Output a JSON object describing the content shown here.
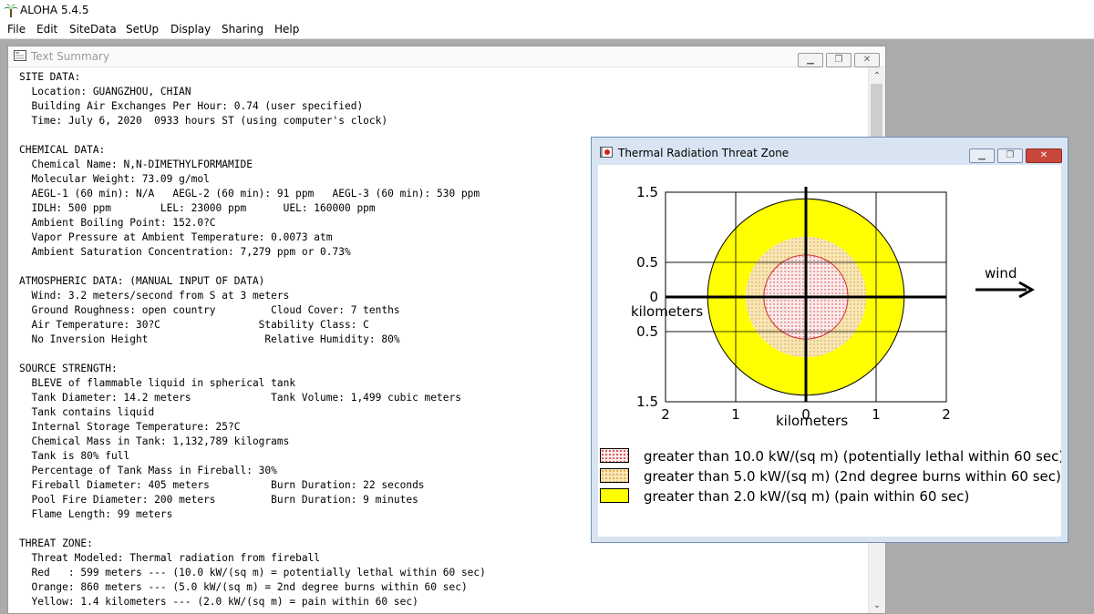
{
  "app": {
    "title": "ALOHA 5.4.5",
    "menu": [
      "File",
      "Edit",
      "SiteData",
      "SetUp",
      "Display",
      "Sharing",
      "Help"
    ]
  },
  "text_summary": {
    "title": "Text Summary",
    "lines": [
      "SITE DATA:",
      "  Location: GUANGZHOU, CHIAN",
      "  Building Air Exchanges Per Hour: 0.74 (user specified)",
      "  Time: July 6, 2020  0933 hours ST (using computer's clock)",
      "",
      "CHEMICAL DATA:",
      "  Chemical Name: N,N-DIMETHYLFORMAMIDE",
      "  Molecular Weight: 73.09 g/mol",
      "  AEGL-1 (60 min): N/A   AEGL-2 (60 min): 91 ppm   AEGL-3 (60 min): 530 ppm",
      "  IDLH: 500 ppm        LEL: 23000 ppm      UEL: 160000 ppm",
      "  Ambient Boiling Point: 152.0?C",
      "  Vapor Pressure at Ambient Temperature: 0.0073 atm",
      "  Ambient Saturation Concentration: 7,279 ppm or 0.73%",
      "",
      "ATMOSPHERIC DATA: (MANUAL INPUT OF DATA)",
      "  Wind: 3.2 meters/second from S at 3 meters",
      "  Ground Roughness: open country         Cloud Cover: 7 tenths",
      "  Air Temperature: 30?C                Stability Class: C",
      "  No Inversion Height                   Relative Humidity: 80%",
      "",
      "SOURCE STRENGTH:",
      "  BLEVE of flammable liquid in spherical tank",
      "  Tank Diameter: 14.2 meters             Tank Volume: 1,499 cubic meters",
      "  Tank contains liquid",
      "  Internal Storage Temperature: 25?C",
      "  Chemical Mass in Tank: 1,132,789 kilograms",
      "  Tank is 80% full",
      "  Percentage of Tank Mass in Fireball: 30%",
      "  Fireball Diameter: 405 meters          Burn Duration: 22 seconds",
      "  Pool Fire Diameter: 200 meters         Burn Duration: 9 minutes",
      "  Flame Length: 99 meters",
      "",
      "THREAT ZONE:",
      "  Threat Modeled: Thermal radiation from fireball",
      "  Red   : 599 meters --- (10.0 kW/(sq m) = potentially lethal within 60 sec)",
      "  Orange: 860 meters --- (5.0 kW/(sq m) = 2nd degree burns within 60 sec)",
      "  Yellow: 1.4 kilometers --- (2.0 kW/(sq m) = pain within 60 sec)"
    ]
  },
  "threat_window": {
    "title": "Thermal Radiation Threat Zone",
    "y_unit": "kilometers",
    "x_unit": "kilometers",
    "y_ticks": [
      "1.5",
      "0.5",
      "0",
      "0.5",
      "1.5"
    ],
    "x_ticks": [
      "2",
      "1",
      "0",
      "1",
      "2"
    ],
    "wind_label": "wind",
    "legend": [
      "greater than 10.0 kW/(sq m) (potentially lethal within 60 sec)",
      "greater than 5.0 kW/(sq m) (2nd degree burns within 60 sec)",
      "greater than 2.0 kW/(sq m) (pain within 60 sec)"
    ],
    "zones_km": {
      "red": 0.599,
      "orange": 0.86,
      "yellow": 1.4
    },
    "colors": {
      "yellow": "#ffff00",
      "orange_fill": "#f7e6b8",
      "red_fill": "#fbeaea",
      "red_line": "#d23030"
    }
  }
}
